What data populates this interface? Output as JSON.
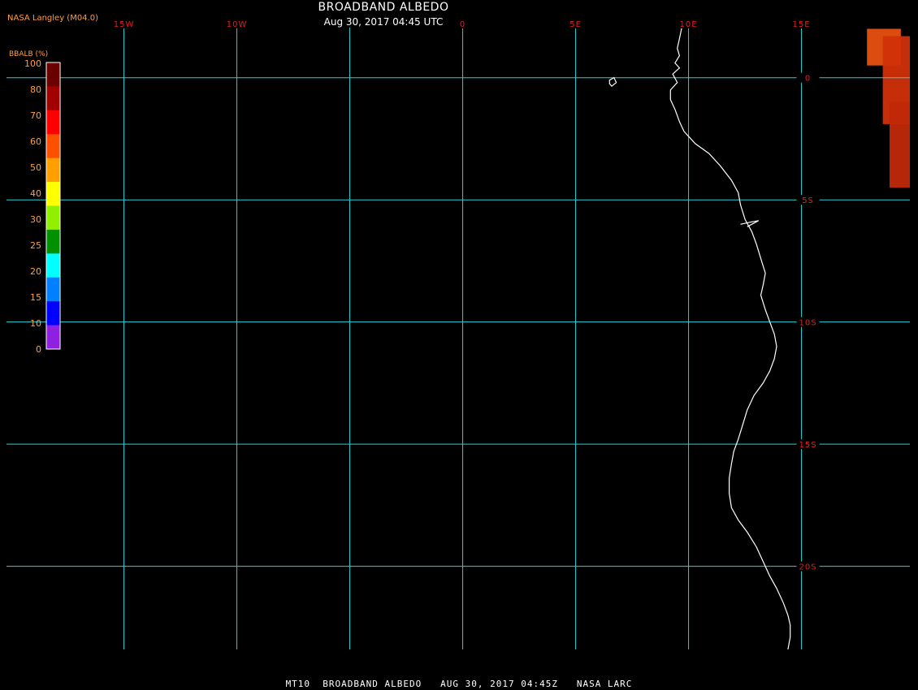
{
  "title": "BROADBAND ALBEDO",
  "subtitle": "Aug 30, 2017 04:45 UTC",
  "producer": "NASA Langley (M04.0)",
  "footer": "MT10  BROADBAND ALBEDO   AUG 30, 2017 04:45Z   NASA LARC",
  "colors": {
    "background": "#000000",
    "grid": "#28d0d8",
    "grid_label": "#e02020",
    "coastline": "#ffffff",
    "producer_text": "#ffa040",
    "legend_text": "#ffa040"
  },
  "map": {
    "projection": "equirectangular",
    "lon_range": [
      -20.2,
      19.8
    ],
    "lat_range": [
      2.05,
      -23.4
    ],
    "meridians": [
      {
        "lon": -15,
        "label": "15W"
      },
      {
        "lon": -10,
        "label": "10W"
      },
      {
        "lon": -5,
        "label": ""
      },
      {
        "lon": 0,
        "label": "0"
      },
      {
        "lon": 5,
        "label": "5E"
      },
      {
        "lon": 10,
        "label": "10E"
      },
      {
        "lon": 15,
        "label": "15E"
      }
    ],
    "parallels": [
      {
        "lat": 0,
        "label": "0"
      },
      {
        "lat": -5,
        "label": "5S"
      },
      {
        "lat": -10,
        "label": "10S"
      },
      {
        "lat": -15,
        "label": "15S"
      },
      {
        "lat": -20,
        "label": "20S"
      },
      {
        "lat": -25,
        "label": ""
      }
    ],
    "coastline": [
      [
        9.7,
        2.05
      ],
      [
        9.6,
        1.6
      ],
      [
        9.5,
        1.2
      ],
      [
        9.6,
        0.9
      ],
      [
        9.4,
        0.6
      ],
      [
        9.6,
        0.4
      ],
      [
        9.3,
        0.15
      ],
      [
        9.5,
        -0.2
      ],
      [
        9.2,
        -0.5
      ],
      [
        9.2,
        -0.9
      ],
      [
        9.4,
        -1.3
      ],
      [
        9.6,
        -1.8
      ],
      [
        9.8,
        -2.2
      ],
      [
        10.3,
        -2.7
      ],
      [
        10.9,
        -3.1
      ],
      [
        11.4,
        -3.6
      ],
      [
        11.9,
        -4.2
      ],
      [
        12.2,
        -4.7
      ],
      [
        12.3,
        -5.2
      ],
      [
        12.5,
        -5.8
      ],
      [
        12.8,
        -6.3
      ],
      [
        13.0,
        -6.8
      ],
      [
        13.2,
        -7.4
      ],
      [
        13.4,
        -8.0
      ],
      [
        13.3,
        -8.5
      ],
      [
        13.2,
        -8.9
      ],
      [
        13.4,
        -9.5
      ],
      [
        13.6,
        -10.0
      ],
      [
        13.8,
        -10.5
      ],
      [
        13.9,
        -11.0
      ],
      [
        13.8,
        -11.5
      ],
      [
        13.6,
        -12.0
      ],
      [
        13.3,
        -12.5
      ],
      [
        12.9,
        -13.0
      ],
      [
        12.6,
        -13.6
      ],
      [
        12.4,
        -14.2
      ],
      [
        12.2,
        -14.8
      ],
      [
        12.0,
        -15.3
      ],
      [
        11.9,
        -15.8
      ],
      [
        11.8,
        -16.4
      ],
      [
        11.8,
        -17.0
      ],
      [
        11.9,
        -17.6
      ],
      [
        12.2,
        -18.1
      ],
      [
        12.6,
        -18.6
      ],
      [
        13.0,
        -19.2
      ],
      [
        13.3,
        -19.8
      ],
      [
        13.6,
        -20.4
      ],
      [
        13.9,
        -20.9
      ],
      [
        14.2,
        -21.5
      ],
      [
        14.4,
        -22.0
      ],
      [
        14.5,
        -22.4
      ],
      [
        14.5,
        -22.9
      ],
      [
        14.4,
        -23.4
      ]
    ],
    "island": [
      [
        6.5,
        -0.1
      ],
      [
        6.7,
        -0.0
      ],
      [
        6.8,
        -0.2
      ],
      [
        6.6,
        -0.35
      ],
      [
        6.5,
        -0.25
      ]
    ],
    "estuary": [
      [
        12.3,
        -6.0
      ],
      [
        12.8,
        -5.9
      ],
      [
        13.1,
        -5.85
      ],
      [
        12.6,
        -6.1
      ]
    ],
    "overlay_cells": [
      {
        "lon0": 17.9,
        "lon1": 19.4,
        "lat0": 2.0,
        "lat1": 0.5,
        "color": "#e85010"
      },
      {
        "lon0": 18.6,
        "lon1": 19.8,
        "lat0": 1.7,
        "lat1": -1.9,
        "color": "#d03008"
      },
      {
        "lon0": 18.9,
        "lon1": 19.8,
        "lat0": -1.0,
        "lat1": -4.5,
        "color": "#c02808"
      }
    ]
  },
  "legend": {
    "title": "BBALB (%)",
    "ticks": [
      "100",
      "80",
      "70",
      "60",
      "50",
      "40",
      "30",
      "25",
      "20",
      "15",
      "10",
      "0"
    ],
    "bins": [
      "#6a0000",
      "#a00000",
      "#ff0000",
      "#ff5000",
      "#ffa000",
      "#ffff00",
      "#90f000",
      "#009000",
      "#00ffff",
      "#0080ff",
      "#0000ff",
      "#9020e0"
    ]
  }
}
